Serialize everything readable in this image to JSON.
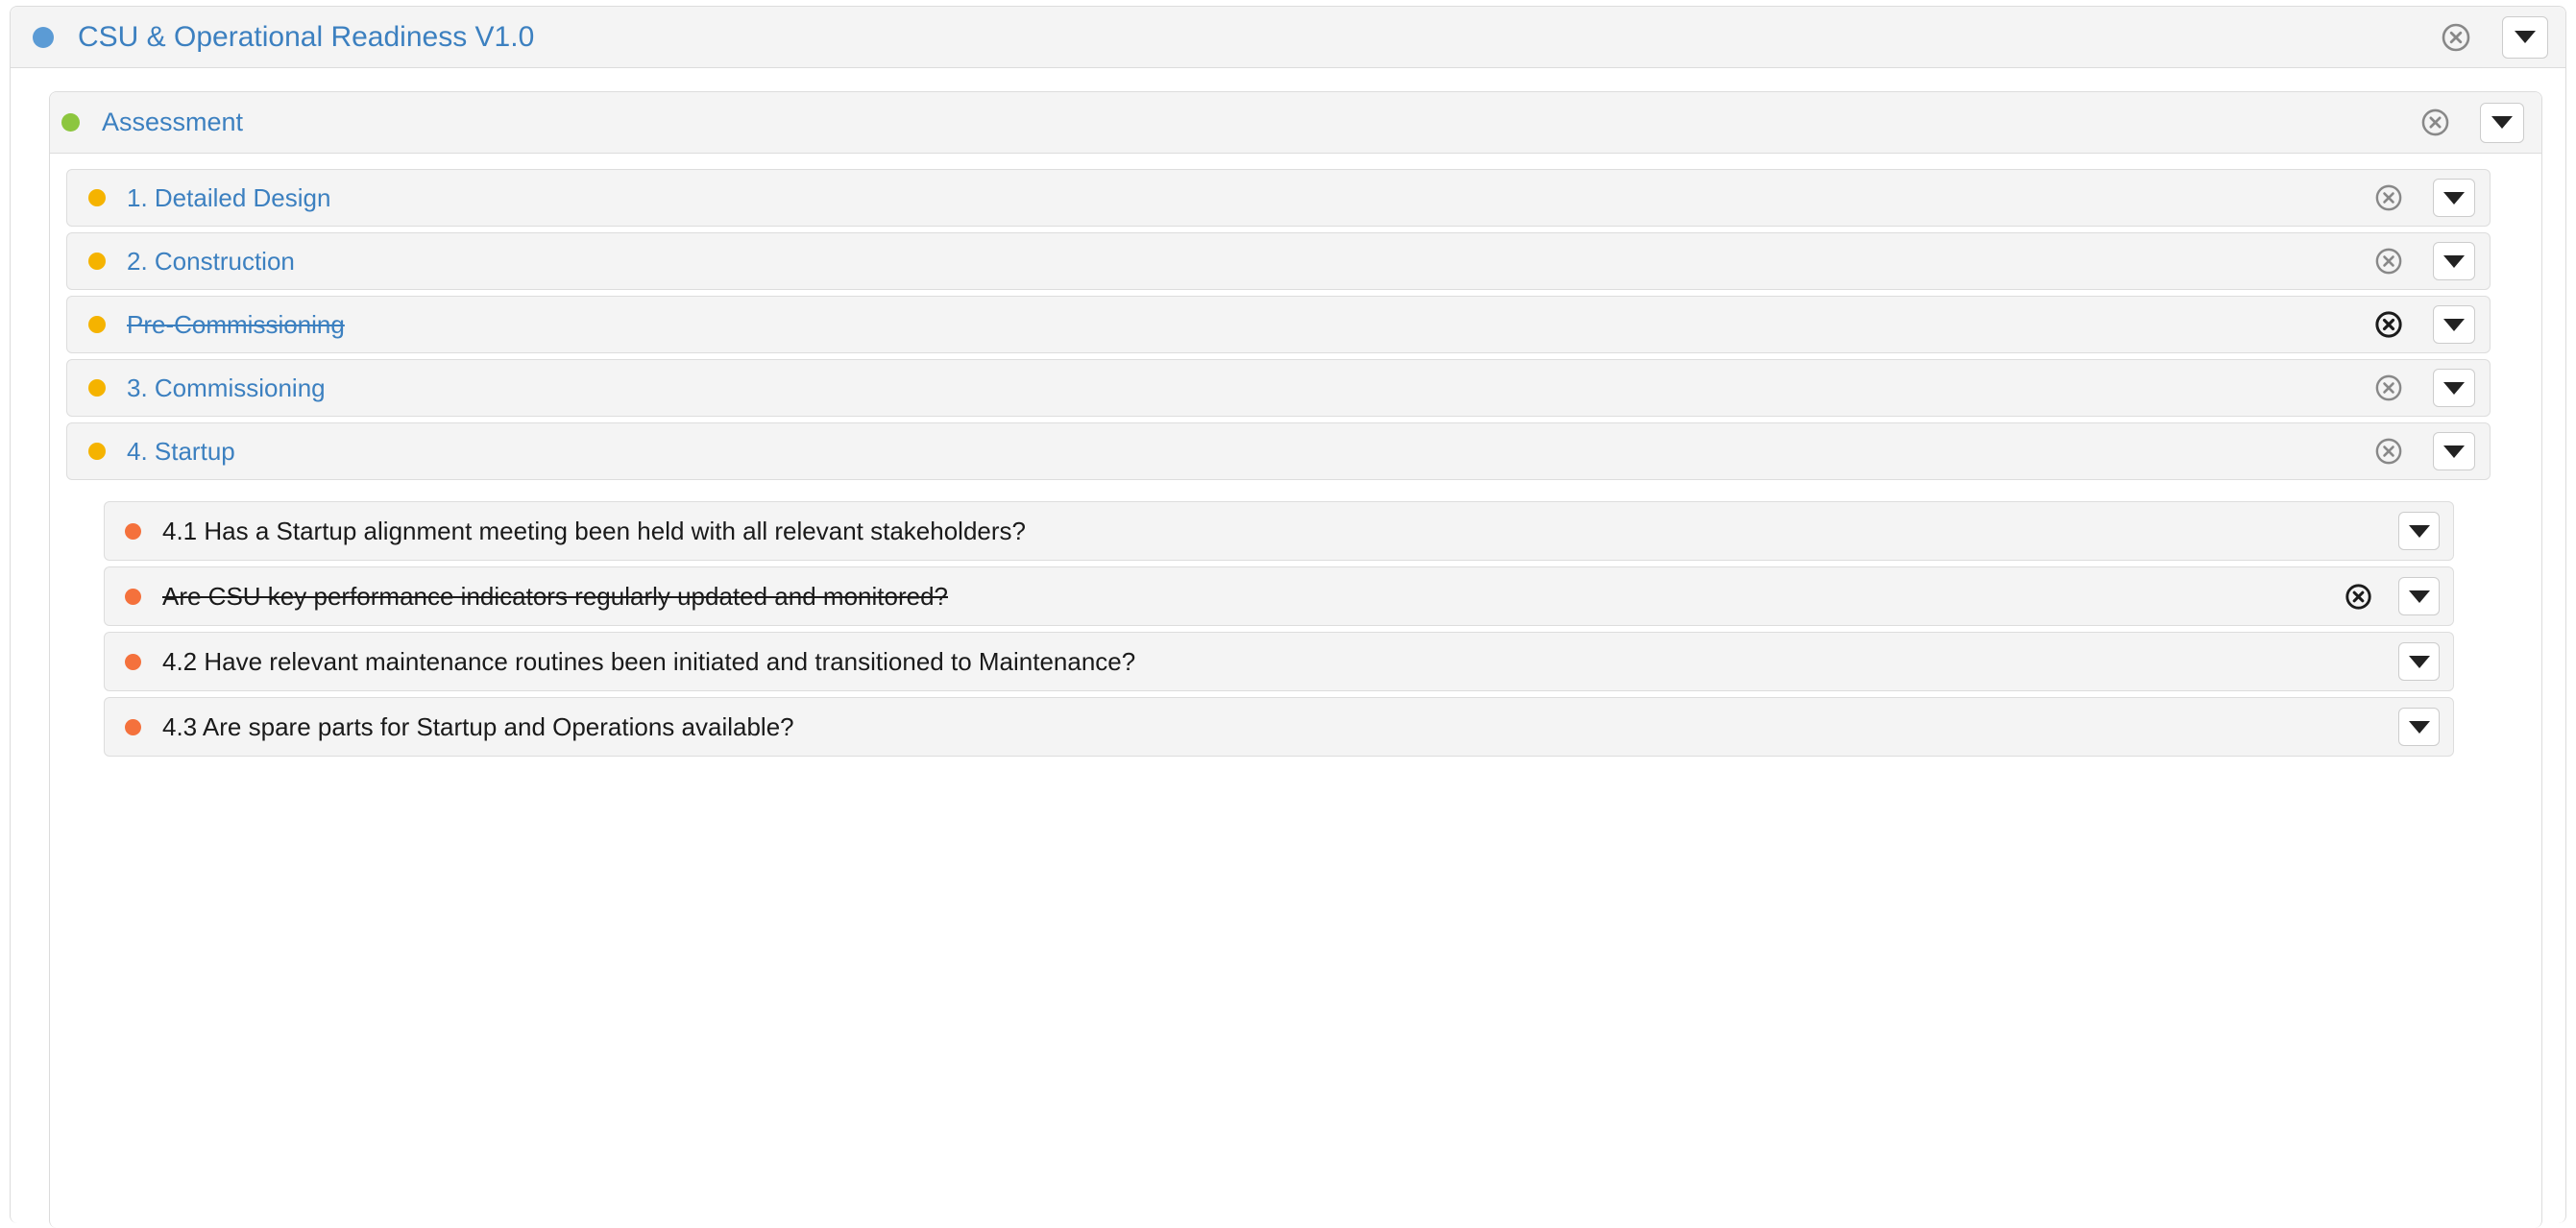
{
  "survey": {
    "title": "CSU & Operational Readiness V1.0",
    "status_dot_color": "#5b9bd5",
    "remove_icon": "circle-x-icon",
    "expand_icon": "chevron-down-icon"
  },
  "assessment": {
    "title": "Assessment",
    "status_dot_color": "#8cc63e",
    "remove_icon": "circle-x-icon",
    "expand_icon": "chevron-down-icon"
  },
  "colors": {
    "link_blue": "#3c80c0",
    "section_dot": "#f5b300",
    "question_dot": "#f4713c",
    "x_inactive": "#888888",
    "x_active": "#1b1b1b",
    "row_bg": "#f4f4f4",
    "row_border": "#dddddd",
    "panel_bg": "#ffffff"
  },
  "sections": [
    {
      "label": "1. Detailed Design",
      "struck": false,
      "dot_color": "#f5b300",
      "x_active": false,
      "questions": []
    },
    {
      "label": "2. Construction",
      "struck": false,
      "dot_color": "#f5b300",
      "x_active": false,
      "questions": []
    },
    {
      "label": "Pre-Commissioning",
      "struck": true,
      "dot_color": "#f5b300",
      "x_active": true,
      "questions": []
    },
    {
      "label": "3. Commissioning",
      "struck": false,
      "dot_color": "#f5b300",
      "x_active": false,
      "questions": []
    },
    {
      "label": "4. Startup",
      "struck": false,
      "dot_color": "#f5b300",
      "x_active": false,
      "questions": [
        {
          "label": "4.1 Has a Startup alignment meeting been held with all relevant stakeholders?",
          "struck": false,
          "dot_color": "#f4713c",
          "show_x": false,
          "x_active": false
        },
        {
          "label": "Are CSU key performance indicators regularly updated and monitored?",
          "struck": true,
          "dot_color": "#f4713c",
          "show_x": true,
          "x_active": true
        },
        {
          "label": "4.2 Have relevant maintenance routines been initiated and transitioned to Maintenance?",
          "struck": false,
          "dot_color": "#f4713c",
          "show_x": false,
          "x_active": false
        },
        {
          "label": "4.3 Are spare parts for Startup and Operations available?",
          "struck": false,
          "dot_color": "#f4713c",
          "show_x": false,
          "x_active": false
        }
      ]
    }
  ]
}
